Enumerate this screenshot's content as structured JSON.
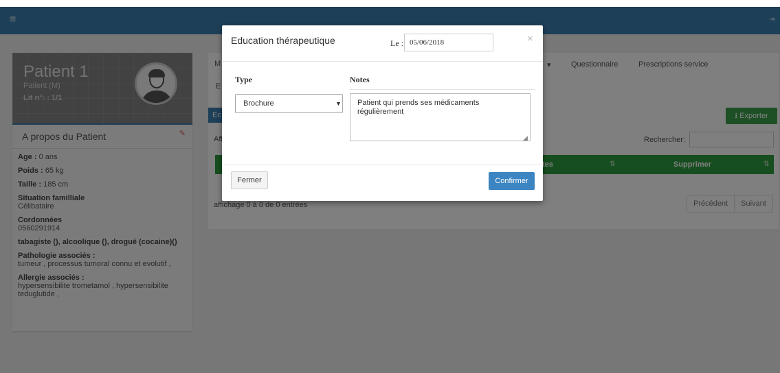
{
  "patient": {
    "name": "Patient 1",
    "sex": "Patient (M)",
    "bed": "Lit n°: : 1/1"
  },
  "about": {
    "title": "A propos du Patient",
    "age_label": "Age :",
    "age_value": "0 ans",
    "weight_label": "Poids :",
    "weight_value": "65 kg",
    "height_label": "Taille :",
    "height_value": "185 cm",
    "family_label": "Situation familliale",
    "family_value": "Célibataire",
    "contact_label": "Cordonnées",
    "contact_value": "0560291914",
    "habits": "tabagiste (), alcoolique (), drogué (cocaine)()",
    "pathology_label": "Pathologie associés :",
    "pathology_value": "tumeur , processus tumoral connu et evolutif ,",
    "allergy_label": "Allergie associés :",
    "allergy_value": "hypersensibilite trometamol , hypersensibilite teduglutide ,"
  },
  "main": {
    "tab_m": "M",
    "tab_e": "E",
    "tab_dropdown_caret": "▾",
    "tab_questionnaire": "Questionnaire",
    "tab_prescriptions": "Prescriptions service",
    "header_prefix": "Ec",
    "export_label": "Exporter",
    "show_prefix": "Aff",
    "search_label": "Rechercher:",
    "col_notes": "tes",
    "col_delete": "Supprimer",
    "info": "affichage 0 à 0 de 0 entrées",
    "prev": "Précédent",
    "next": "Suivant"
  },
  "modal": {
    "title": "Education thérapeutique",
    "date_label": "Le :",
    "date_value": "05/06/2018",
    "close": "×",
    "type_header": "Type",
    "notes_header": "Notes",
    "type_selected": "Brochure",
    "notes_value": "Patient qui prends ses médicaments régulièrement",
    "fermer": "Fermer",
    "confirmer": "Confirmer"
  },
  "colors": {
    "topbar": "#3d7eb0",
    "export": "#3aa14a",
    "table_header": "#2f9d3f",
    "confirm": "#3c85c2",
    "edit_icon": "#d9534f"
  },
  "icons": [
    "menu-icon",
    "logout-icon",
    "pencil-icon",
    "download-icon",
    "sort-icon",
    "close-icon",
    "chevron-down-icon",
    "resize-icon"
  ]
}
